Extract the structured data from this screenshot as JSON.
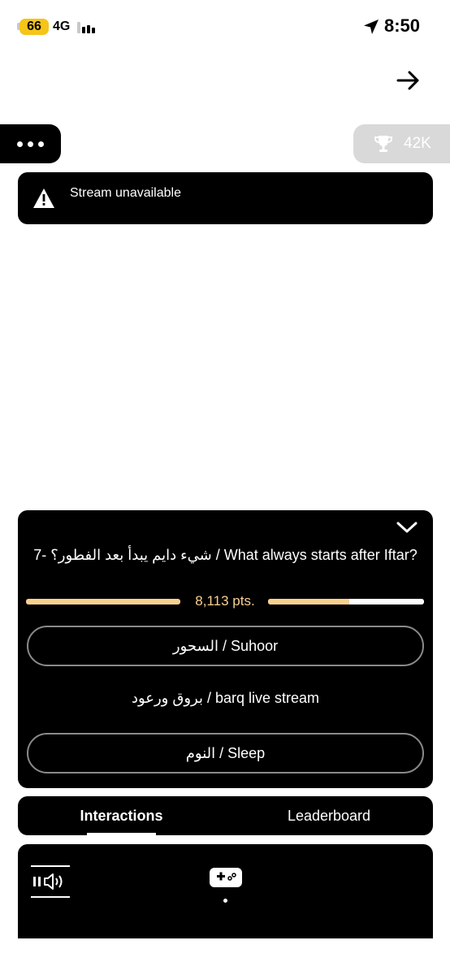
{
  "status_bar": {
    "battery": "66",
    "network": "4G",
    "time": "8:50"
  },
  "header": {
    "next_icon": "arrow-right-icon"
  },
  "menu": {
    "icon": "more-dots-icon"
  },
  "trophy": {
    "icon": "trophy-icon",
    "count": "42K"
  },
  "alert": {
    "icon": "warning-icon",
    "message": "Stream unavailable"
  },
  "question_card": {
    "collapse_icon": "chevron-down-icon",
    "question": "7- شيء دايم يبدأ بعد الفطور؟ / What always starts after Iftar?",
    "points": "8,113 pts.",
    "options": [
      {
        "label": "السحور / Suhoor"
      },
      {
        "label": "بروق ورعود / barq live stream"
      },
      {
        "label": "النوم / Sleep"
      }
    ]
  },
  "tabs": [
    {
      "label": "Interactions",
      "active": true
    },
    {
      "label": "Leaderboard",
      "active": false
    }
  ],
  "panel": {
    "audio_icon": "pause-volume-icon",
    "game_icon": "gamepad-icon"
  },
  "colors": {
    "accent": "#f9d08f",
    "battery": "#f5c518",
    "card": "#000000"
  }
}
